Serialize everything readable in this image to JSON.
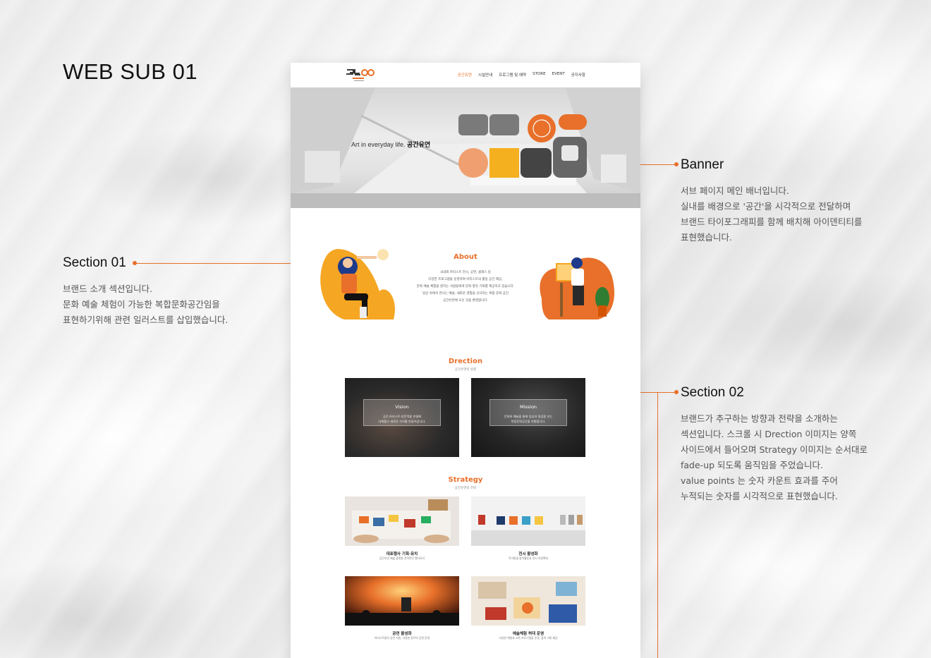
{
  "page_heading": "WEB SUB 01",
  "accent_color": "#e8702a",
  "annotations": {
    "section01": {
      "title": "Section 01",
      "desc": "브랜드 소개 섹션입니다.\n문화 예술 체험이 가능한 복합문화공간임을\n표현하기위해 관련 일러스트를 삽입했습니다."
    },
    "banner": {
      "title": "Banner",
      "desc": "서브 페이지 메인 배너입니다.\n실내를 배경으로 '공간'을 시각적으로 전달하며\n브랜드 타이포그래피를 함께 배치해 아이덴티티를\n표현했습니다."
    },
    "section02": {
      "title": "Section 02",
      "desc": "브랜드가 추구하는 방향과 전략을 소개하는\n섹션입니다.  스크롤 시 Drection 이미지는 양쪽\n사이드에서 들어오며 Strategy 이미지는 순서대로\nfade-up 되도록 움직임을 주었습니다.\nvalue points 는 숫자 카운트 효과를 주어\n누적되는 숫자를 시각적으로 표현했습니다."
    }
  },
  "site": {
    "nav": {
      "items": [
        "공간유연",
        "시설안내",
        "프로그램 및 예약",
        "STORE",
        "EVENT",
        "공지사항"
      ],
      "active_index": 0
    },
    "banner": {
      "tagline": "Art in everyday life.",
      "brand": "공간유연"
    },
    "about": {
      "title": "About",
      "body": "국내외 아티스트 전시, 공연, 클래스 등\n다양한 프로그램을 운영하여 아티스트의 활동 공간 제공,\n문화 예술 체험을 원하는 사람들에게 문화 향유 기회를 제공하고 있습니다.\n일상 속에서 만나는 예술, 새로운 경험을 선사하는 복합 문화 공간\n공간유연에 오신 것을 환영합니다."
    },
    "direction": {
      "title": "Drection",
      "subtitle": "공간유연의 방향",
      "cards": [
        {
          "label": "Vision",
          "text": "공간·아티스트·방문객을 연결해\n다채롭고 새로운 가치를 만들어갑니다."
        },
        {
          "label": "Mission",
          "text": "문화와 예술을 통해 일상과 영감을 잇는\n복합문화공간을 지향합니다."
        }
      ]
    },
    "strategy": {
      "title": "Strategy",
      "subtitle": "공간유연의 전략",
      "items": [
        {
          "title": "대표행사 기획·유치",
          "desc": "공간유연 예술 플랫폼 전략적인 행사유치"
        },
        {
          "title": "전시 활성화",
          "desc": "작가발굴 창작활동과 전시 지원확대"
        },
        {
          "title": "공연 활성화",
          "desc": "아티스트들의 공연 지원, 다양한 장르의 공연 운영"
        },
        {
          "title": "예술체험 허대 운영",
          "desc": "다양한 체험과 교육 프로그램을 운영, 참여 기회 제공"
        }
      ]
    }
  }
}
